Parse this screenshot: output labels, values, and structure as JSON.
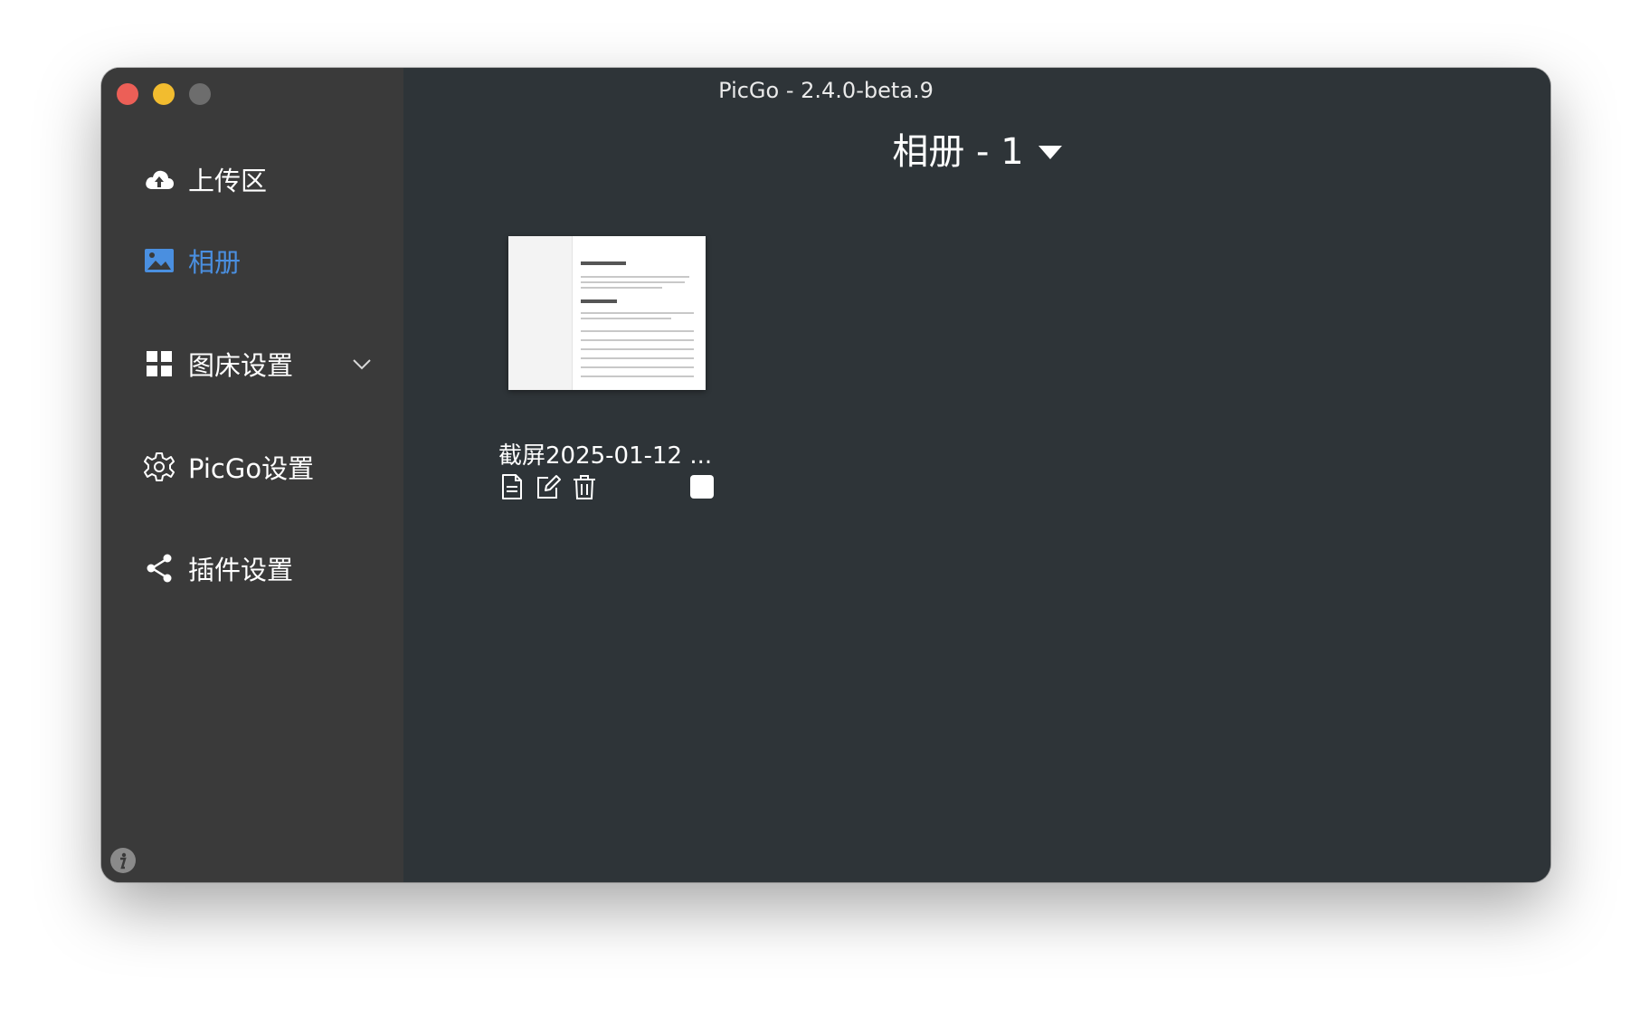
{
  "window": {
    "title": "PicGo - 2.4.0-beta.9"
  },
  "sidebar": {
    "items": [
      {
        "label": "上传区",
        "icon": "cloud-upload-icon"
      },
      {
        "label": "相册",
        "icon": "image-icon",
        "active": true
      },
      {
        "label": "图床设置",
        "icon": "grid-icon",
        "expandable": true
      },
      {
        "label": "PicGo设置",
        "icon": "gear-icon"
      },
      {
        "label": "插件设置",
        "icon": "share-icon"
      }
    ],
    "info_icon": "info-icon"
  },
  "main": {
    "album_title": "相册 - 1",
    "cards": [
      {
        "name": "截屏2025-01-12 ...",
        "actions": [
          "copy-link-icon",
          "edit-icon",
          "delete-icon"
        ],
        "checked": false
      }
    ]
  },
  "colors": {
    "sidebar_bg": "#3a3a3a",
    "main_bg": "#2e3438",
    "accent": "#4a8fe0",
    "text": "#ffffff"
  }
}
